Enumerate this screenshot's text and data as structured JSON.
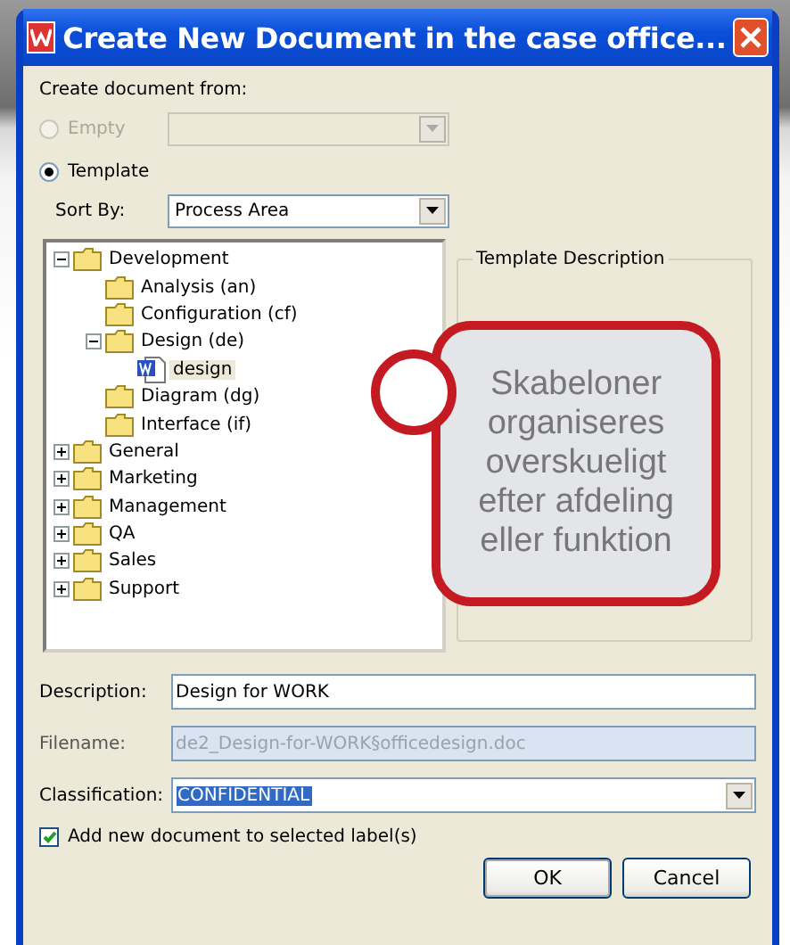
{
  "window": {
    "title": "Create New Document in the case office..."
  },
  "source_label": "Create document from:",
  "options": [
    {
      "label": "Empty",
      "selected": false,
      "disabled": true
    },
    {
      "label": "Template",
      "selected": true,
      "disabled": false
    }
  ],
  "sort_by": {
    "label": "Sort By:",
    "value": "Process Area"
  },
  "tree": [
    {
      "label": "Development",
      "kind": "folder",
      "expanded": true,
      "selected": false,
      "children": [
        {
          "label": "Analysis (an)",
          "kind": "folder",
          "selected": false
        },
        {
          "label": "Configuration (cf)",
          "kind": "folder",
          "selected": false
        },
        {
          "label": "Design (de)",
          "kind": "folder",
          "expanded": true,
          "selected": false,
          "children": [
            {
              "label": "design",
              "kind": "document",
              "selected": true
            }
          ]
        },
        {
          "label": "Diagram (dg)",
          "kind": "folder",
          "selected": false
        },
        {
          "label": "Interface (if)",
          "kind": "folder",
          "selected": false
        }
      ]
    },
    {
      "label": "General",
      "kind": "folder",
      "expanded": false,
      "selected": false
    },
    {
      "label": "Marketing",
      "kind": "folder",
      "expanded": false,
      "selected": false
    },
    {
      "label": "Management",
      "kind": "folder",
      "expanded": false,
      "selected": false
    },
    {
      "label": "QA",
      "kind": "folder",
      "expanded": false,
      "selected": false
    },
    {
      "label": "Sales",
      "kind": "folder",
      "expanded": false,
      "selected": false
    },
    {
      "label": "Support",
      "kind": "folder",
      "expanded": false,
      "selected": false
    }
  ],
  "description_panel": {
    "title": "Template Description"
  },
  "callout": {
    "text": "Skabeloner organiseres overskueligt efter afdeling eller funktion"
  },
  "fields": [
    {
      "label": "Description:",
      "value": "Design for WORK",
      "kind": "text"
    },
    {
      "label": "Filename:",
      "value": "de2_Design-for-WORK§officedesign.doc",
      "kind": "readonly"
    },
    {
      "label": "Classification:",
      "value": "CONFIDENTIAL",
      "kind": "dropdown"
    }
  ],
  "add_to_label": {
    "label": "Add new document to selected label(s)",
    "checked": true
  },
  "buttons": [
    {
      "label": "OK",
      "default": true
    },
    {
      "label": "Cancel",
      "default": false
    }
  ]
}
